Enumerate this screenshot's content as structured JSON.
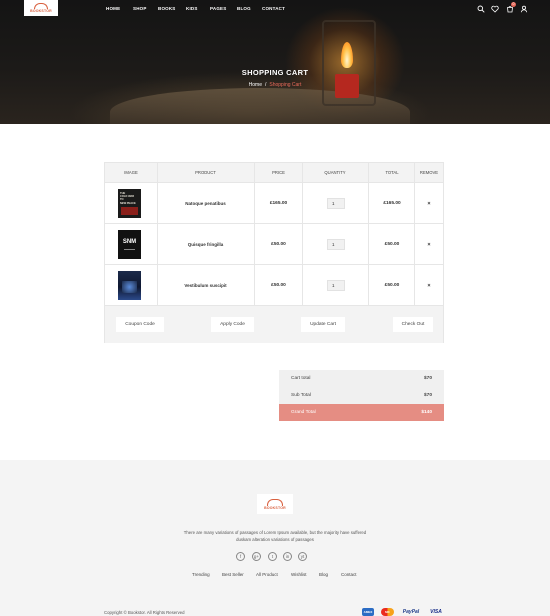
{
  "brand": {
    "logo_text": "BOOKSTOR",
    "accent": "#e8695a"
  },
  "nav": {
    "items": [
      "HOME",
      "SHOP",
      "BOOKS",
      "KIDS",
      "PAGES",
      "BLOG",
      "CONTACT"
    ],
    "cart_count": "0",
    "icons": [
      "search-icon",
      "heart-icon",
      "cart-icon",
      "user-icon"
    ]
  },
  "hero": {
    "title": "SHOPPING CART",
    "breadcrumb": {
      "home": "Home",
      "sep": "/",
      "current": "Shopping Cart"
    }
  },
  "cart": {
    "headers": [
      "IMAGE",
      "PRODUCT",
      "PRICE",
      "QUANTITY",
      "TOTAL",
      "REMOVE"
    ],
    "rows": [
      {
        "cover_text": "THE\nCOLD WAR\nTO\nNEW PEACE",
        "product": "Natoque penatibus",
        "price": "£165.00",
        "qty": "1",
        "total": "£165.00",
        "remove": "×"
      },
      {
        "cover_text": "SNM",
        "product": "Quisque fringilla",
        "price": "£50.00",
        "qty": "1",
        "total": "£50.00",
        "remove": "×"
      },
      {
        "cover_text": "",
        "product": "Vestibulum suscipit",
        "price": "£50.00",
        "qty": "1",
        "total": "£50.00",
        "remove": "×"
      }
    ],
    "actions": [
      "Coupon Code",
      "Apply Code",
      "Update Cart",
      "Check Out"
    ]
  },
  "totals": {
    "cart_total": {
      "label": "Cart total",
      "value": "$70"
    },
    "sub_total": {
      "label": "Sub Total",
      "value": "$70"
    },
    "grand_total": {
      "label": "Grand Total",
      "value": "$140"
    }
  },
  "footer": {
    "logo_text": "BOOKSTOR",
    "description": "There are many variations of passages of Lorem Ipsum available, but the majority have suffered duskam alteration variations of passages",
    "social": [
      "f",
      "g+",
      "t",
      "in",
      "yt"
    ],
    "social_icons": [
      "facebook-icon",
      "google-plus-icon",
      "twitter-icon",
      "linkedin-icon",
      "youtube-icon"
    ],
    "links": [
      "Trending",
      "Best Seller",
      "All Product",
      "Wishlist",
      "Blog",
      "Contact"
    ],
    "copyright": "Copyright © Bookstor. All Rights Reserved",
    "payments": [
      "AMEX",
      "MC",
      "PayPal",
      "VISA"
    ]
  }
}
